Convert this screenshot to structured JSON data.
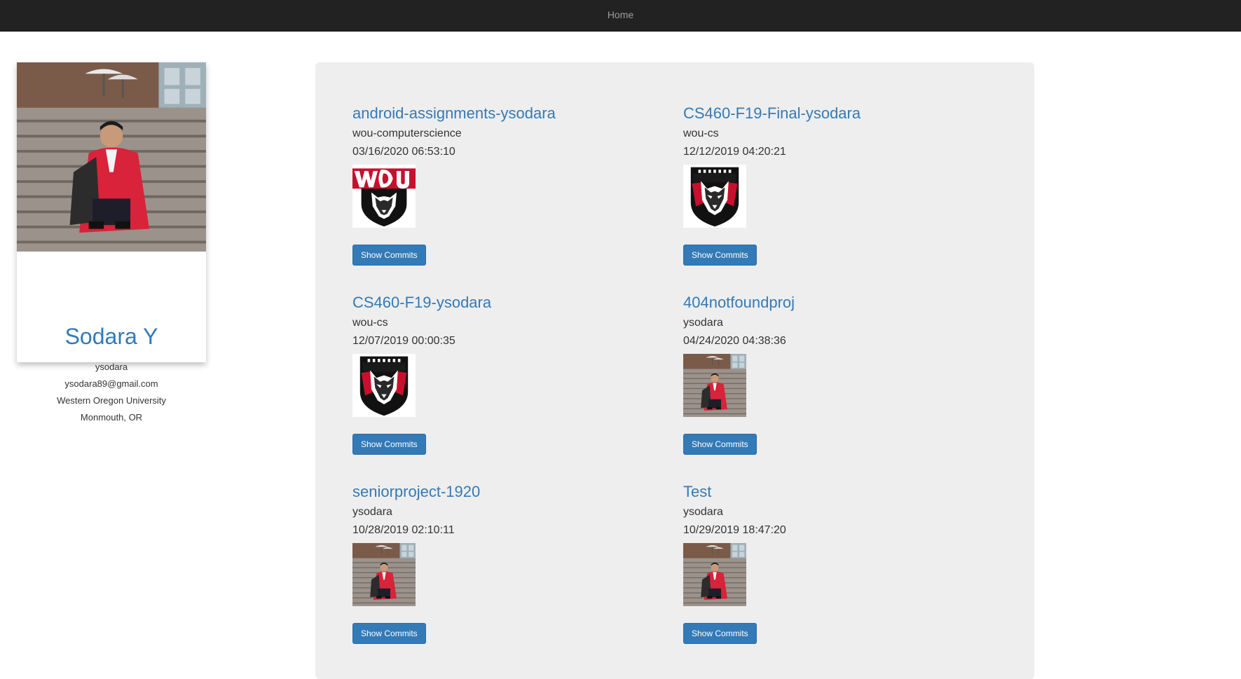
{
  "nav": {
    "home_label": "Home"
  },
  "profile": {
    "name": "Sodara Y",
    "username": "ysodara",
    "email": "ysodara89@gmail.com",
    "school": "Western Oregon University",
    "location": "Monmouth, OR"
  },
  "repos": [
    {
      "title": "android-assignments-ysodara",
      "owner": "wou-computerscience",
      "date": "03/16/2020 06:53:10",
      "image": "wou-logo",
      "button": "Show Commits"
    },
    {
      "title": "CS460-F19-Final-ysodara",
      "owner": "wou-cs",
      "date": "12/12/2019 04:20:21",
      "image": "wolves-logo",
      "button": "Show Commits"
    },
    {
      "title": "CS460-F19-ysodara",
      "owner": "wou-cs",
      "date": "12/07/2019 00:00:35",
      "image": "wolves-logo",
      "button": "Show Commits"
    },
    {
      "title": "404notfoundproj",
      "owner": "ysodara",
      "date": "04/24/2020 04:38:36",
      "image": "profile-photo",
      "button": "Show Commits"
    },
    {
      "title": "seniorproject-1920",
      "owner": "ysodara",
      "date": "10/28/2019 02:10:11",
      "image": "profile-photo",
      "button": "Show Commits"
    },
    {
      "title": "Test",
      "owner": "ysodara",
      "date": "10/29/2019 18:47:20",
      "image": "profile-photo",
      "button": "Show Commits"
    }
  ],
  "colors": {
    "link": "#337ab7",
    "navbar": "#222222",
    "panel": "#eeeeee",
    "button": "#337ab7"
  }
}
